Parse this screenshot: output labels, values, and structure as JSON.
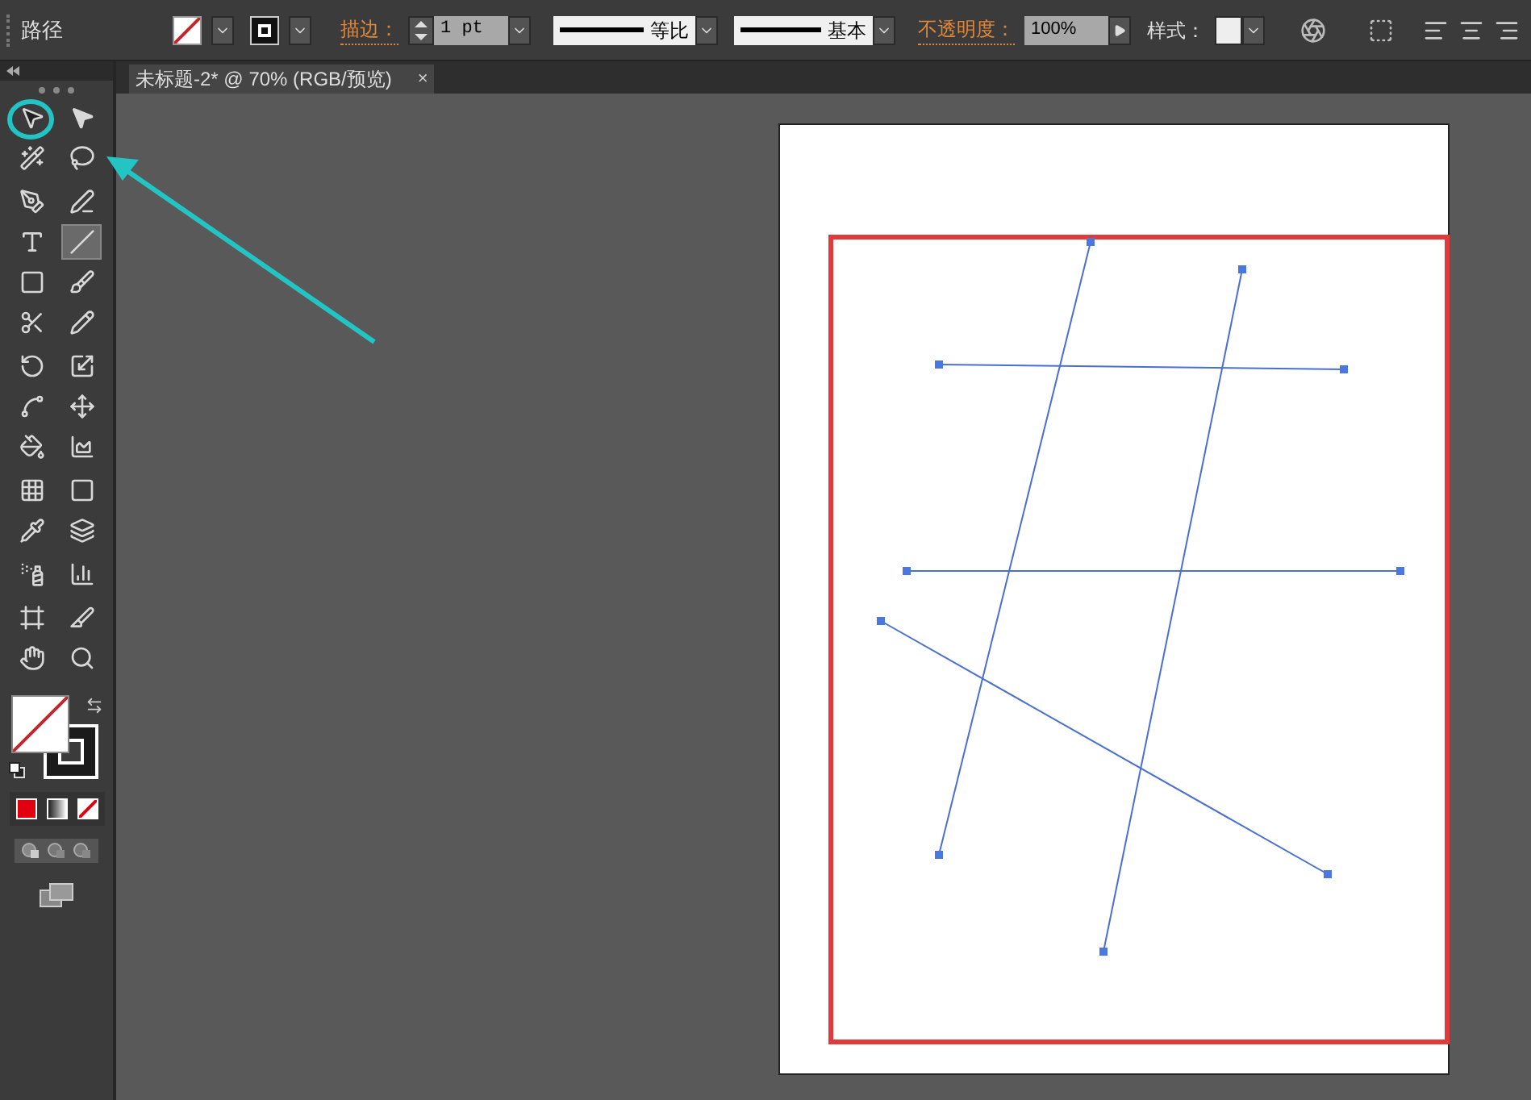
{
  "control_bar": {
    "label": "路径",
    "stroke_label": "描边：",
    "stroke_weight": "1 pt",
    "profile_label": "等比",
    "brush_label": "基本",
    "opacity_label": "不透明度：",
    "opacity": "100%",
    "style_label": "样式："
  },
  "document_tab": {
    "title": "未标题-2* @ 70% (RGB/预览)",
    "close": "×"
  },
  "tools": [
    {
      "kind": "selection",
      "selected": false
    },
    {
      "kind": "direct",
      "selected": false
    },
    {
      "kind": "wand",
      "selected": false
    },
    {
      "kind": "lasso",
      "selected": false
    },
    {
      "kind": "pen",
      "selected": false
    },
    {
      "kind": "curvature",
      "selected": false
    },
    {
      "kind": "type",
      "selected": false
    },
    {
      "kind": "line",
      "selected": true
    },
    {
      "kind": "rectangle",
      "selected": false
    },
    {
      "kind": "brush",
      "selected": false
    },
    {
      "kind": "scissors",
      "selected": false
    },
    {
      "kind": "pencil",
      "selected": false
    },
    {
      "kind": "rotate",
      "selected": false
    },
    {
      "kind": "scale",
      "selected": false
    },
    {
      "kind": "warp",
      "selected": false
    },
    {
      "kind": "transform",
      "selected": false
    },
    {
      "kind": "bucket",
      "selected": false
    },
    {
      "kind": "graph",
      "selected": false
    },
    {
      "kind": "mesh",
      "selected": false
    },
    {
      "kind": "gradient",
      "selected": false
    },
    {
      "kind": "eyedropper",
      "selected": false
    },
    {
      "kind": "blend",
      "selected": false
    },
    {
      "kind": "spray",
      "selected": false
    },
    {
      "kind": "column",
      "selected": false
    },
    {
      "kind": "artboard",
      "selected": false
    },
    {
      "kind": "slice",
      "selected": false
    },
    {
      "kind": "hand",
      "selected": false
    },
    {
      "kind": "zoom",
      "selected": false
    }
  ]
}
